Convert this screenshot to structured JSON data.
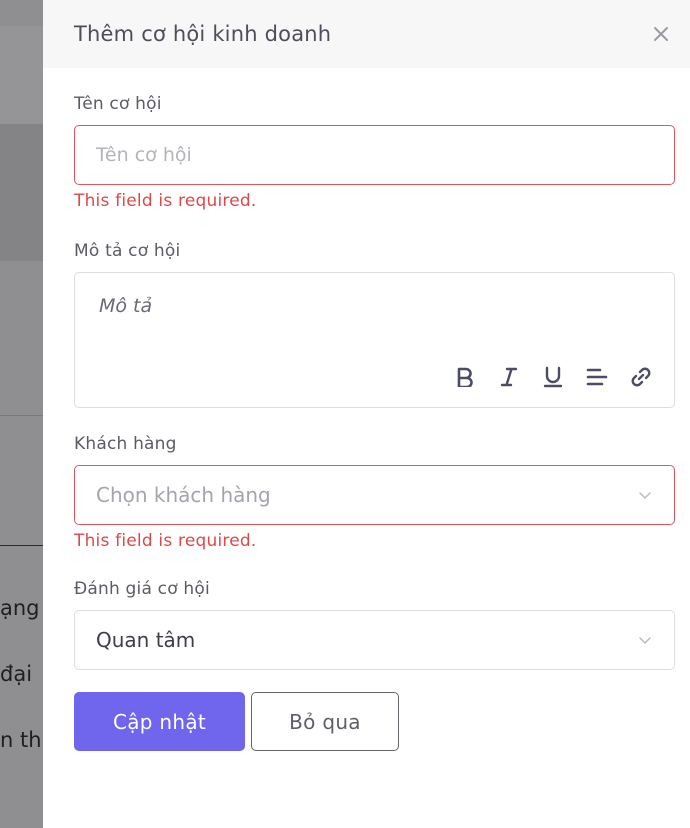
{
  "background": {
    "text_lines": [
      "ạng",
      "đại",
      "n th"
    ]
  },
  "drawer": {
    "title": "Thêm cơ hội kinh doanh",
    "close_icon": "close-icon"
  },
  "form": {
    "name": {
      "label": "Tên cơ hội",
      "placeholder": "Tên cơ hội",
      "value": "",
      "error": "This field is required."
    },
    "description": {
      "label": "Mô tả cơ hội",
      "placeholder": "Mô tả",
      "toolbar": [
        "bold-icon",
        "italic-icon",
        "underline-icon",
        "align-icon",
        "link-icon"
      ]
    },
    "customer": {
      "label": "Khách hàng",
      "placeholder": "Chọn khách hàng",
      "value": "",
      "error": "This field is required."
    },
    "rating": {
      "label": "Đánh giá cơ hội",
      "value": "Quan tâm"
    }
  },
  "actions": {
    "submit_label": "Cập nhật",
    "cancel_label": "Bỏ qua"
  },
  "colors": {
    "primary": "#7066ee",
    "error": "#e04848",
    "overlay": "#8f8f92"
  }
}
